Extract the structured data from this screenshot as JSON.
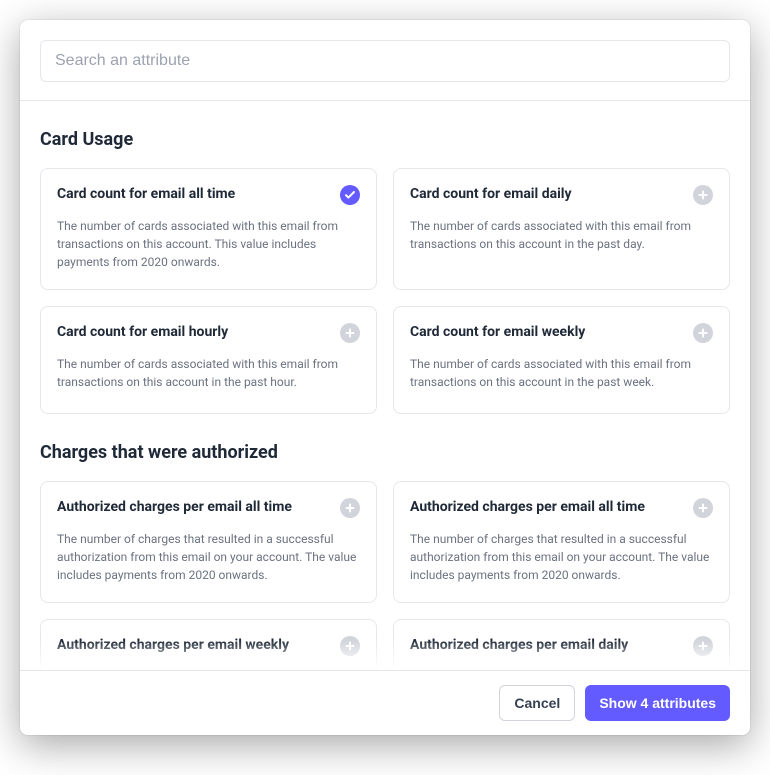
{
  "search": {
    "placeholder": "Search an attribute"
  },
  "sections": {
    "card_usage": {
      "title": "Card Usage",
      "cards": [
        {
          "title": "Card count for email all time",
          "desc": "The number of cards associated with this email from transactions on this account. This value includes payments from 2020 onwards.",
          "selected": true
        },
        {
          "title": "Card count for email daily",
          "desc": "The number of cards associated with this email from transactions on this account in the past day.",
          "selected": false
        },
        {
          "title": "Card count for email hourly",
          "desc": "The number of cards associated with this email from transactions on this account in the past hour.",
          "selected": false
        },
        {
          "title": "Card count for email weekly",
          "desc": "The number of cards associated with this email from transactions on this account in the past week.",
          "selected": false
        }
      ]
    },
    "authorized_charges": {
      "title": "Charges that were authorized",
      "cards": [
        {
          "title": "Authorized charges per email all time",
          "desc": "The number of charges that resulted in a successful authorization from this email on your account. The value includes payments from 2020 onwards.",
          "selected": false
        },
        {
          "title": "Authorized charges per email all time",
          "desc": "The number of charges that resulted in a successful authorization from this email on your account. The value includes payments from 2020 onwards.",
          "selected": false
        },
        {
          "title": "Authorized charges per email weekly",
          "desc": "",
          "selected": false
        },
        {
          "title": "Authorized charges per email daily",
          "desc": "",
          "selected": false
        }
      ]
    }
  },
  "footer": {
    "cancel": "Cancel",
    "submit": "Show 4 attributes"
  }
}
